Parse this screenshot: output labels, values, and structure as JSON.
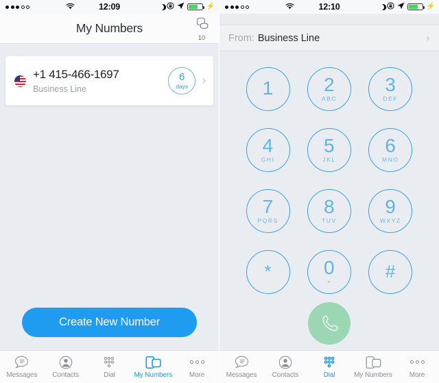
{
  "left_screen": {
    "status_bar": {
      "signal_filled": 3,
      "signal_empty": 2,
      "wifi_icon": "wifi-icon",
      "time": "12:09",
      "moon_icon": "do-not-disturb-moon-icon",
      "rotation_lock_icon": "rotation-lock-icon",
      "location_icon": "location-arrow-icon",
      "battery_icon": "battery-icon",
      "battery_level_percent": 70,
      "charging_icon": "charging-bolt-icon"
    },
    "navbar": {
      "title": "My Numbers",
      "credits_icon": "coins-stack-icon",
      "credits_count": "10"
    },
    "number_card": {
      "flag_icon": "us-flag-icon",
      "phone_number": "+1 415-466-1697",
      "line_label": "Business Line",
      "badge_value": "6",
      "badge_unit": "days",
      "chevron_icon": "chevron-right-icon"
    },
    "cta": {
      "label": "Create New Number"
    },
    "tabbar": {
      "active": "My Numbers",
      "items": [
        {
          "label": "Messages",
          "icon": "messages-bubble-icon"
        },
        {
          "label": "Contacts",
          "icon": "contacts-person-icon"
        },
        {
          "label": "Dial",
          "icon": "dialpad-dots-icon"
        },
        {
          "label": "My Numbers",
          "icon": "my-numbers-phones-icon"
        },
        {
          "label": "More",
          "icon": "more-ellipsis-icon"
        }
      ]
    }
  },
  "right_screen": {
    "status_bar": {
      "signal_filled": 3,
      "signal_empty": 2,
      "wifi_icon": "wifi-icon",
      "time": "12:10",
      "moon_icon": "do-not-disturb-moon-icon",
      "rotation_lock_icon": "rotation-lock-icon",
      "location_icon": "location-arrow-icon",
      "battery_icon": "battery-icon",
      "battery_level_percent": 70,
      "charging_icon": "charging-bolt-icon"
    },
    "from_bar": {
      "label": "From:",
      "value": "Business Line",
      "chevron_icon": "chevron-right-icon"
    },
    "dialpad": {
      "keys": [
        {
          "digit": "1",
          "letters": ""
        },
        {
          "digit": "2",
          "letters": "ABC"
        },
        {
          "digit": "3",
          "letters": "DEF"
        },
        {
          "digit": "4",
          "letters": "GHI"
        },
        {
          "digit": "5",
          "letters": "JKL"
        },
        {
          "digit": "6",
          "letters": "MNO"
        },
        {
          "digit": "7",
          "letters": "PQRS"
        },
        {
          "digit": "8",
          "letters": "TUV"
        },
        {
          "digit": "9",
          "letters": "WXYZ"
        },
        {
          "digit": "*",
          "letters": ""
        },
        {
          "digit": "0",
          "letters": "+"
        },
        {
          "digit": "#",
          "letters": ""
        }
      ],
      "call_button_icon": "phone-handset-icon"
    },
    "tabbar": {
      "active": "Dial",
      "items": [
        {
          "label": "Messages",
          "icon": "messages-bubble-icon"
        },
        {
          "label": "Contacts",
          "icon": "contacts-person-icon"
        },
        {
          "label": "Dial",
          "icon": "dialpad-dots-icon"
        },
        {
          "label": "My Numbers",
          "icon": "my-numbers-phones-icon"
        },
        {
          "label": "More",
          "icon": "more-ellipsis-icon"
        }
      ]
    }
  },
  "colors": {
    "accent_blue": "#1f9bef",
    "dialpad_blue": "#3aa3e3",
    "call_green": "#9ad7b2",
    "battery_green": "#4cd363",
    "background": "#e9ecf1"
  }
}
